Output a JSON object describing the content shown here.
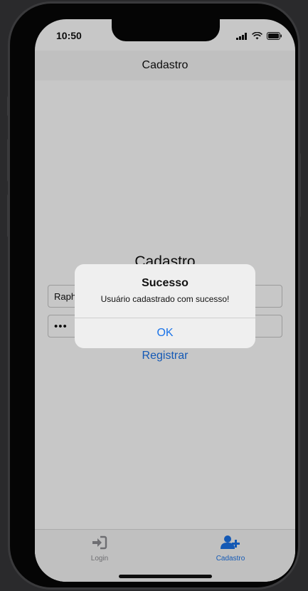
{
  "status": {
    "time": "10:50"
  },
  "nav": {
    "title": "Cadastro"
  },
  "form": {
    "heading": "Cadastro",
    "username_value": "Raph",
    "password_value": "•••",
    "register_label": "Registrar"
  },
  "alert": {
    "title": "Sucesso",
    "message": "Usuário cadastrado com sucesso!",
    "ok_label": "OK"
  },
  "tabs": [
    {
      "label": "Login",
      "icon": "login-icon",
      "active": false
    },
    {
      "label": "Cadastro",
      "icon": "add-user-icon",
      "active": true
    }
  ],
  "colors": {
    "accent": "#1a73e8",
    "inactive": "#8e8e93"
  }
}
